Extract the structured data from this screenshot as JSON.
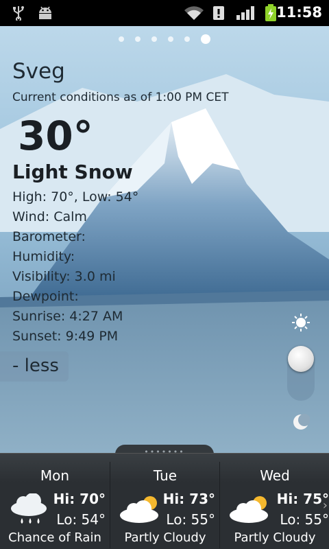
{
  "status_bar": {
    "time": "11:58",
    "icons": [
      "usb-icon",
      "android-debug-icon",
      "wifi-icon",
      "alert-icon",
      "signal-icon",
      "battery-charging-icon"
    ]
  },
  "pager": {
    "pages": 6,
    "active": 6
  },
  "current": {
    "city": "Sveg",
    "as_of": "Current conditions as of  1:00 PM CET",
    "temperature": "30°",
    "condition": "Light Snow",
    "details": [
      "High: 70°, Low: 54°",
      "Wind: Calm",
      "Barometer:",
      "Humidity:",
      "Visibility: 3.0 mi",
      "Dewpoint:",
      "Sunrise: 4:27 AM",
      "Sunset: 9:49 PM"
    ]
  },
  "less_button": "- less",
  "day_night_slider": {
    "top_icon": "sun-icon",
    "bottom_icon": "moon-icon",
    "position": "day"
  },
  "forecast": [
    {
      "day": "Mon",
      "hi": "Hi: 70°",
      "lo": "Lo: 54°",
      "desc": "Chance of Rain",
      "icon": "rain-cloud-icon"
    },
    {
      "day": "Tue",
      "hi": "Hi: 73°",
      "lo": "Lo: 55°",
      "desc": "Partly Cloudy",
      "icon": "partly-cloudy-icon"
    },
    {
      "day": "Wed",
      "hi": "Hi: 75°",
      "lo": "Lo: 55°",
      "desc": "Partly Cloudy",
      "icon": "partly-cloudy-icon"
    }
  ],
  "colors": {
    "text_dark": "#1a1f24",
    "forecast_bg": "#2b2f33",
    "status_bg": "#000000"
  }
}
